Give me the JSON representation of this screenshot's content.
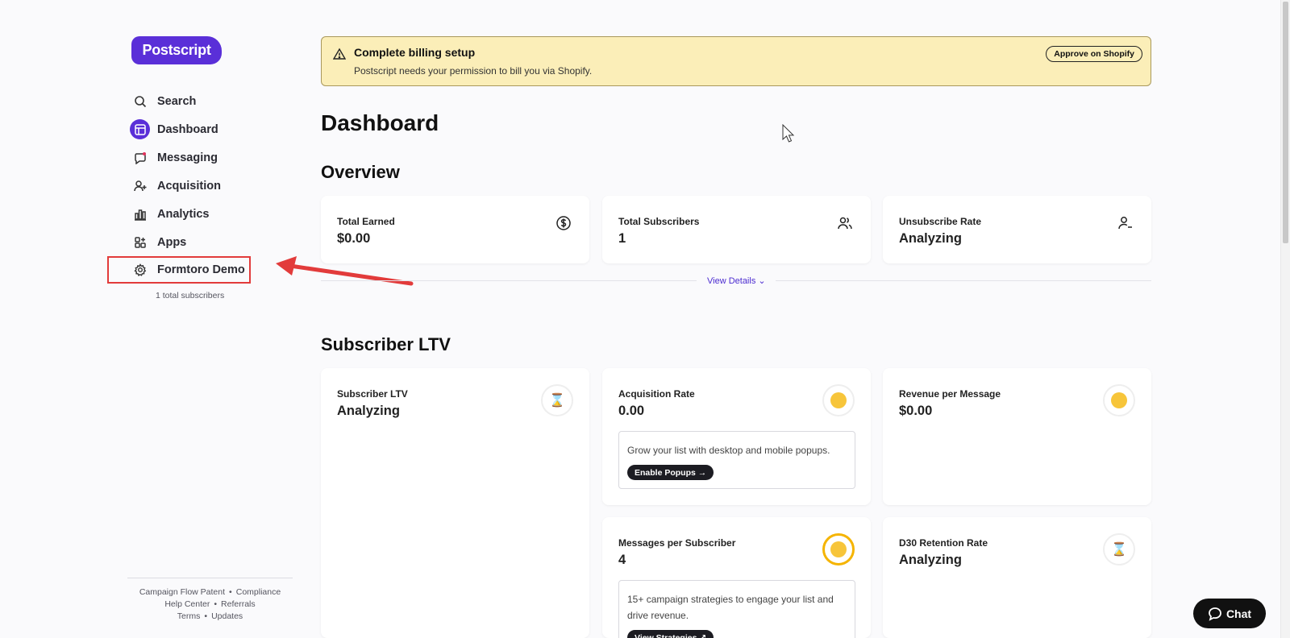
{
  "brand": {
    "logo_text": "Postscript",
    "accent": "#5a2fd8"
  },
  "sidebar": {
    "items": [
      {
        "label": "Search",
        "icon": "search-icon"
      },
      {
        "label": "Dashboard",
        "icon": "dashboard-icon",
        "active": true
      },
      {
        "label": "Messaging",
        "icon": "message-icon"
      },
      {
        "label": "Acquisition",
        "icon": "user-add-icon"
      },
      {
        "label": "Analytics",
        "icon": "bar-chart-icon"
      },
      {
        "label": "Apps",
        "icon": "apps-icon"
      }
    ],
    "shop": {
      "label": "Formtoro Demo",
      "icon": "gear-icon",
      "subtext": "1 total subscribers"
    },
    "footer": {
      "links": [
        "Campaign Flow Patent",
        "Compliance",
        "Help Center",
        "Referrals",
        "Terms",
        "Updates"
      ]
    }
  },
  "banner": {
    "title": "Complete billing setup",
    "text": "Postscript needs your permission to bill you via Shopify.",
    "button": "Approve on Shopify"
  },
  "page_title": "Dashboard",
  "overview": {
    "title": "Overview",
    "cards": [
      {
        "label": "Total Earned",
        "value": "$0.00",
        "icon": "dollar-icon"
      },
      {
        "label": "Total Subscribers",
        "value": "1",
        "icon": "users-icon"
      },
      {
        "label": "Unsubscribe Rate",
        "value": "Analyzing",
        "icon": "user-remove-icon"
      }
    ],
    "view_details": "View Details"
  },
  "ltv": {
    "title": "Subscriber LTV",
    "cards": [
      {
        "label": "Subscriber LTV",
        "value": "Analyzing",
        "icon": "hourglass-icon"
      },
      {
        "label": "Acquisition Rate",
        "value": "0.00",
        "icon": "thinking-face-icon",
        "tip": "Grow your list with desktop and mobile popups.",
        "tip_button": "Enable Popups →"
      },
      {
        "label": "Revenue per Message",
        "value": "$0.00",
        "icon": "thinking-face-icon"
      },
      {
        "label": "Messages per Subscriber",
        "value": "4",
        "icon": "neutral-face-icon",
        "tip": "15+ campaign strategies to engage your list and drive revenue.",
        "tip_button": "View Strategies ↗"
      },
      {
        "label": "D30 Retention Rate",
        "value": "Analyzing",
        "icon": "hourglass-icon"
      }
    ]
  },
  "chat": {
    "label": "Chat"
  }
}
